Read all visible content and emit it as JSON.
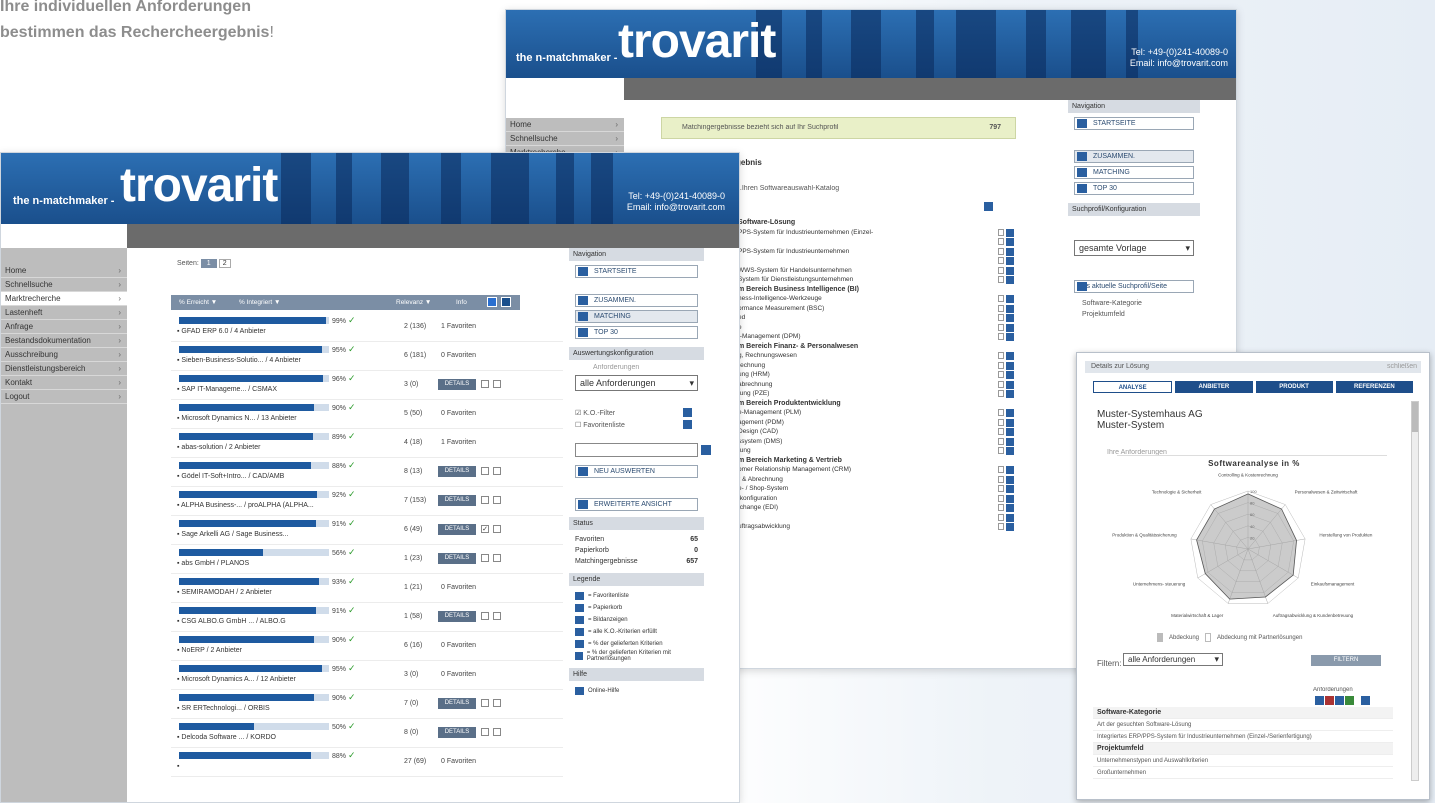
{
  "slogan": {
    "line1": "Ihre individuellen Anforderungen",
    "line2": "bestimmen das Rechercheergebnis",
    "exclam": "!"
  },
  "brand": {
    "tagline": "the n-matchmaker -",
    "logo": "trovarit",
    "contact_line1": "Tel: +49-(0)241-40089-0",
    "contact_line2": "Email: info@trovarit.com"
  },
  "back_window": {
    "nav": [
      "Home",
      "Schnellsuche",
      "Marktrecherche"
    ],
    "banner_text": "Matchingergebnisse bezieht sich auf Ihr Suchprofil",
    "banner_count": "797",
    "heading": "gebnis",
    "subheading": "...Ihren Softwareauswahl-Katalog",
    "items": [
      {
        "t": "Software-Lösung",
        "b": true
      },
      {
        "t": "PPS-System für Industrieunternehmen (Einzel-",
        "b": false
      },
      {
        "t": "",
        "b": false
      },
      {
        "t": "PPS-System für Industrieunternehmen",
        "b": false
      },
      {
        "t": "",
        "b": false
      },
      {
        "t": "WWS-System für Handelsunternehmen",
        "b": false
      },
      {
        "t": "System für Dienstleistungsunternehmen",
        "b": false
      },
      {
        "t": "m Bereich Business Intelligence (BI)",
        "b": true
      },
      {
        "t": "ness-Intelligence-Werkzeuge",
        "b": false
      },
      {
        "t": "ormance Measurement (BSC)",
        "b": false
      },
      {
        "t": "ed",
        "b": false
      },
      {
        "t": "e",
        "b": false
      },
      {
        "t": "t-Management (DPM)",
        "b": false
      },
      {
        "t": "m Bereich Finanz- & Personalwesen",
        "b": true
      },
      {
        "t": "g, Rechnungswesen",
        "b": false
      },
      {
        "t": "rechnung",
        "b": false
      },
      {
        "t": "ung (HRM)",
        "b": false
      },
      {
        "t": "abrechnung",
        "b": false
      },
      {
        "t": "tung (PZE)",
        "b": false
      },
      {
        "t": "m Bereich Produktentwicklung",
        "b": true
      },
      {
        "t": "e-Management (PLM)",
        "b": false
      },
      {
        "t": "agement (PDM)",
        "b": false
      },
      {
        "t": "Design (CAD)",
        "b": false
      },
      {
        "t": "ssystem (DMS)",
        "b": false
      },
      {
        "t": "tung",
        "b": false
      },
      {
        "t": "m Bereich Marketing & Vertrieb",
        "b": true
      },
      {
        "t": "omer Relationship Management (CRM)",
        "b": false
      },
      {
        "t": "r & Abrechnung",
        "b": false
      },
      {
        "t": "e- / Shop-System",
        "b": false
      },
      {
        "t": "tkonfiguration",
        "b": false
      },
      {
        "t": "tchange (EDI)",
        "b": false
      },
      {
        "t": "",
        "b": false
      },
      {
        "t": "uftragsabwicklung",
        "b": false
      }
    ],
    "side": {
      "nav_title": "Navigation",
      "btn_start": "STARTSEITE",
      "btn_zusammen": "ZUSAMMEN.",
      "btn_matching": "MATCHING",
      "btn_top": "TOP 30",
      "cfg_title": "Suchprofil/Konfiguration",
      "select": "gesamte Vorlage",
      "btn_save": "als aktuelle Suchprofil/Seite",
      "tree1": "Software-Kategorie",
      "tree2": "Projektumfeld"
    }
  },
  "front_window": {
    "nav": [
      "Home",
      "Schnellsuche",
      "Marktrecherche",
      "Lastenheft",
      "Anfrage",
      "Bestandsdokumentation",
      "Ausschreibung",
      "Dienstleistungsbereich",
      "Kontakt",
      "Logout"
    ],
    "pages_label": "Seiten:",
    "pages": [
      "1",
      "2"
    ],
    "table_headers": {
      "score": "% Erreicht ▼",
      "integ": "% Integriert ▼",
      "rel": "Relevanz ▼",
      "info": "Info"
    },
    "rows": [
      {
        "pct": "99%",
        "fill": 0.98,
        "name": "GFAD ERP 6.0 / 4 Anbieter",
        "rel": "2 (136)",
        "fav": "1 Favoriten",
        "det": false
      },
      {
        "pct": "95%",
        "fill": 0.95,
        "name": "Sieben-Business-Solutio... / 4 Anbieter",
        "rel": "6 (181)",
        "fav": "0 Favoriten",
        "det": false
      },
      {
        "pct": "96%",
        "fill": 0.96,
        "name": "SAP IT-Manageme... / CSMAX",
        "rel": "3 (0)",
        "fav": "",
        "det": true,
        "c1": false,
        "c2": false
      },
      {
        "pct": "90%",
        "fill": 0.9,
        "name": "Microsoft Dynamics N... / 13 Anbieter",
        "rel": "5 (50)",
        "fav": "0 Favoriten",
        "det": false
      },
      {
        "pct": "89%",
        "fill": 0.89,
        "name": "abas-solution / 2 Anbieter",
        "rel": "4 (18)",
        "fav": "1 Favoriten",
        "det": false
      },
      {
        "pct": "88%",
        "fill": 0.88,
        "name": "Gödel IT-Soft+Intro... / CAD/AMB",
        "rel": "8 (13)",
        "fav": "",
        "det": true,
        "c1": false,
        "c2": false
      },
      {
        "pct": "92%",
        "fill": 0.92,
        "name": "ALPHA Business-... / proALPHA (ALPHA...",
        "rel": "7 (153)",
        "fav": "",
        "det": true,
        "c1": false,
        "c2": false
      },
      {
        "pct": "91%",
        "fill": 0.91,
        "name": "Sage Arkelli AG / Sage Business...",
        "rel": "6 (49)",
        "fav": "",
        "det": true,
        "c1": true,
        "c2": false
      },
      {
        "pct": "56%",
        "fill": 0.56,
        "name": "abs GmbH / PLANOS",
        "rel": "1 (23)",
        "fav": "",
        "det": true,
        "c1": false,
        "c2": false
      },
      {
        "pct": "93%",
        "fill": 0.93,
        "name": "SEMIRAMODAH / 2 Anbieter",
        "rel": "1 (21)",
        "fav": "0 Favoriten",
        "det": false
      },
      {
        "pct": "91%",
        "fill": 0.91,
        "name": "CSG ALBO.G GmbH ... / ALBO.G",
        "rel": "1 (58)",
        "fav": "",
        "det": true,
        "c1": false,
        "c2": false
      },
      {
        "pct": "90%",
        "fill": 0.9,
        "name": "NoERP / 2 Anbieter",
        "rel": "6 (16)",
        "fav": "0 Favoriten",
        "det": false
      },
      {
        "pct": "95%",
        "fill": 0.95,
        "name": "Microsoft Dynamics A... / 12 Anbieter",
        "rel": "3 (0)",
        "fav": "0 Favoriten",
        "det": false
      },
      {
        "pct": "90%",
        "fill": 0.9,
        "name": "SR ERTechnologi... / ORBIS",
        "rel": "7 (0)",
        "fav": "",
        "det": true,
        "c1": false,
        "c2": false
      },
      {
        "pct": "50%",
        "fill": 0.5,
        "name": "Delcoda Software ... / KORDO",
        "rel": "8 (0)",
        "fav": "",
        "det": true,
        "c1": false,
        "c2": false
      },
      {
        "pct": "88%",
        "fill": 0.88,
        "name": "",
        "rel": "27 (69)",
        "fav": "0 Favoriten",
        "det": false
      }
    ],
    "details_label": "DETAILS",
    "side": {
      "nav_title": "Navigation",
      "btn_start": "STARTSEITE",
      "btn_zusammen": "ZUSAMMEN.",
      "btn_matching": "MATCHING",
      "btn_top": "TOP 30",
      "cfg_title": "Auswertungskonfiguration",
      "cfg_sub": "Anforderungen",
      "select": "alle Anforderungen",
      "chk1": "K.O.-Filter",
      "chk2": "Favoritenliste",
      "btn_neu": "NEU AUSWERTEN",
      "btn_erw": "ERWEITERTE ANSICHT",
      "stats_title": "Status",
      "stats": [
        {
          "k": "Favoriten",
          "v": "65"
        },
        {
          "k": "Papierkorb",
          "v": "0"
        },
        {
          "k": "Matchingergebnisse",
          "v": "657"
        }
      ],
      "legend_title": "Legende",
      "legend": [
        "= Favoritenliste",
        "= Papierkorb",
        "= Bildanzeigen",
        "= alle K.O.-Kriterien erfüllt",
        "= % der gelieferten Kriterien",
        "= % der gelieferten Kriterien mit Partnerlösungen"
      ],
      "help_title": "Hilfe",
      "help_item": "Online-Hilfe"
    }
  },
  "popup": {
    "title": "Details zur Lösung",
    "close": "schließen",
    "tabs": [
      "ANALYSE",
      "ANBIETER",
      "PRODUKT",
      "REFERENZEN"
    ],
    "company": "Muster-Systemhaus AG",
    "product": "Muster-System",
    "section": "Ihre Anforderungen",
    "chart_title": "Softwareanalyse in %",
    "legend_a": "Abdeckung",
    "legend_b": "Abdeckung mit Partnerlösungen",
    "filter_label": "Filtern:",
    "filter_value": "alle Anforderungen",
    "btn": "FILTERN",
    "col_head": "Anforderungen",
    "list": [
      {
        "t": "Software-Kategorie",
        "b": true
      },
      {
        "t": "Art der gesuchten Software-Lösung",
        "b": false
      },
      {
        "t": "Integriertes ERP/PPS-System für Industrieunternehmen (Einzel-/Serienfertigung)",
        "b": false
      },
      {
        "t": "Projektumfeld",
        "b": true
      },
      {
        "t": "Unternehmenstypen und Auswahlkriterien",
        "b": false
      },
      {
        "t": "Großunternehmen",
        "b": false
      }
    ]
  },
  "chart_data": {
    "type": "radar",
    "title": "Softwareanalyse in %",
    "categories": [
      "Controlling & Kostenrechnung",
      "Personalwesen & Zeitwirtschaft",
      "Herstellung von Produkten",
      "Einkaufsmanagement",
      "Auftragsabwicklung & Kundenbetreuung",
      "Materialwirtschaft & Lager",
      "Unternehmens- steuerung",
      "Produktion & Qualitätssicherung",
      "Technologie & Sicherheit"
    ],
    "series": [
      {
        "name": "Abdeckung",
        "values": [
          95,
          90,
          85,
          90,
          88,
          92,
          85,
          90,
          90
        ]
      }
    ],
    "ylim": [
      0,
      100
    ],
    "ticks": [
      "20",
      "40",
      "60",
      "80",
      "100"
    ]
  }
}
